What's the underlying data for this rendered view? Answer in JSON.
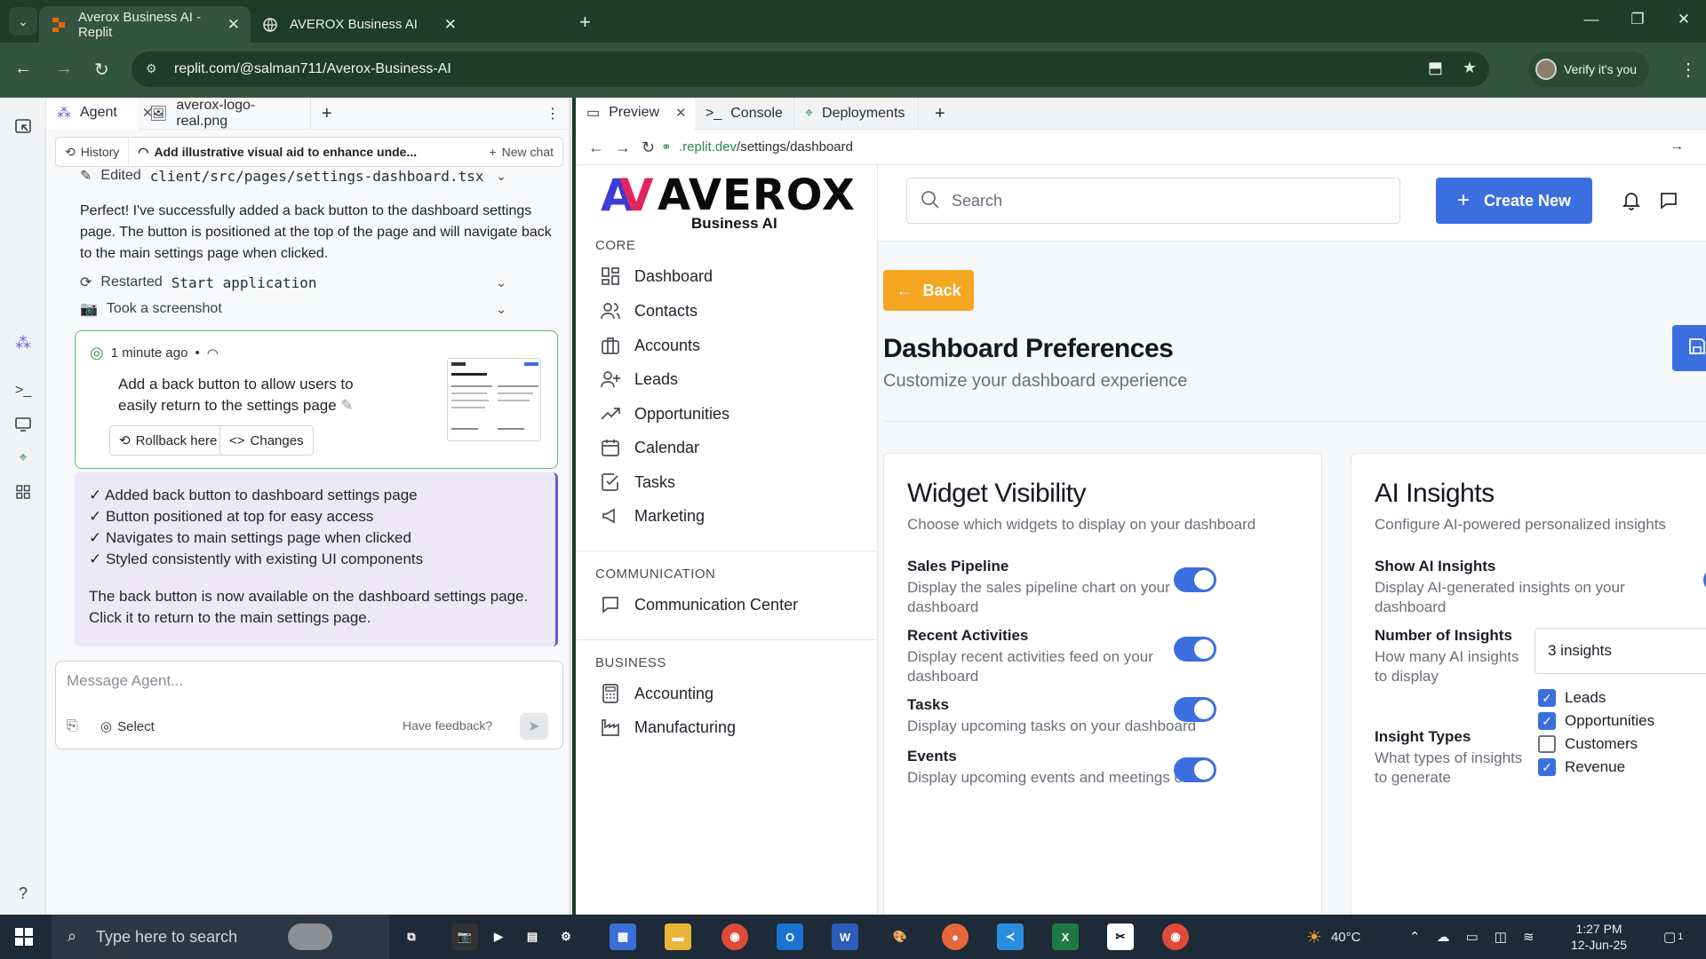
{
  "browser": {
    "tabs": [
      {
        "label": "Averox Business AI - Replit"
      },
      {
        "label": "AVEROX Business AI"
      }
    ],
    "url": "replit.com/@salman711/Averox-Business-AI",
    "profile_label": "Verify it's you"
  },
  "agent_panel": {
    "tabs": [
      {
        "label": "Agent"
      },
      {
        "label": "averox-logo-real.png"
      }
    ],
    "history_label": "History",
    "thread_title": "Add illustrative visual aid to enhance unde...",
    "new_chat_label": "New chat",
    "edited_prefix": "Edited",
    "edited_file": "client/src/pages/settings-dashboard.tsx",
    "message_1": "Perfect! I've successfully added a back button to the dashboard settings page. The button is positioned at the top of the page and will navigate back to the main settings page when clicked.",
    "restarted_prefix": "Restarted",
    "restarted_target": "Start application",
    "screenshot_label": "Took a screenshot",
    "checkpoint": {
      "time": "1 minute ago",
      "description": "Add a back button to allow users to easily return to the settings page",
      "rollback_label": "Rollback here",
      "changes_label": "Changes"
    },
    "summary_items": [
      "✓ Added back button to dashboard settings page",
      "✓ Button positioned at top for easy access",
      "✓ Navigates to main settings page when clicked",
      "✓ Styled consistently with existing UI components"
    ],
    "summary_footer": "The back button is now available on the dashboard settings page. Click it to return to the main settings page.",
    "input_placeholder": "Message Agent...",
    "select_label": "Select",
    "feedback_label": "Have feedback?"
  },
  "preview_panel": {
    "tabs": [
      {
        "label": "Preview"
      },
      {
        "label": "Console"
      },
      {
        "label": "Deployments"
      }
    ],
    "url_host": ".replit.dev",
    "url_path": "/settings/dashboard"
  },
  "app": {
    "logo_word": "AVEROX",
    "logo_mark": "AV",
    "logo_tagline": "Business AI",
    "sections": {
      "core": "CORE",
      "communication": "COMMUNICATION",
      "business": "BUSINESS"
    },
    "nav_core": [
      {
        "label": "Dashboard",
        "icon": "grid-icon"
      },
      {
        "label": "Contacts",
        "icon": "users-icon"
      },
      {
        "label": "Accounts",
        "icon": "briefcase-icon"
      },
      {
        "label": "Leads",
        "icon": "user-plus-icon"
      },
      {
        "label": "Opportunities",
        "icon": "trending-up-icon"
      },
      {
        "label": "Calendar",
        "icon": "calendar-icon"
      },
      {
        "label": "Tasks",
        "icon": "check-square-icon"
      },
      {
        "label": "Marketing",
        "icon": "megaphone-icon"
      }
    ],
    "nav_communication": [
      {
        "label": "Communication Center",
        "icon": "message-square-icon"
      }
    ],
    "nav_business": [
      {
        "label": "Accounting",
        "icon": "calculator-icon"
      },
      {
        "label": "Manufacturing",
        "icon": "factory-icon"
      }
    ],
    "search_placeholder": "Search",
    "create_label": "Create New",
    "back_label": "Back",
    "page_title": "Dashboard Preferences",
    "page_subtitle": "Customize your dashboard experience",
    "widget_card": {
      "title": "Widget Visibility",
      "subtitle": "Choose which widgets to display on your dashboard",
      "options": [
        {
          "title": "Sales Pipeline",
          "desc": "Display the sales pipeline chart on your dashboard",
          "enabled": true
        },
        {
          "title": "Recent Activities",
          "desc": "Display recent activities feed on your dashboard",
          "enabled": true
        },
        {
          "title": "Tasks",
          "desc": "Display upcoming tasks on your dashboard",
          "enabled": true
        },
        {
          "title": "Events",
          "desc": "Display upcoming events and meetings on",
          "enabled": true
        }
      ]
    },
    "ai_card": {
      "title": "AI Insights",
      "subtitle": "Configure AI-powered personalized insights",
      "show_title": "Show AI Insights",
      "show_desc": "Display AI-generated insights on your dashboard",
      "count_title": "Number of Insights",
      "count_desc": "How many AI insights to display",
      "count_value": "3 insights",
      "types_title": "Insight Types",
      "types_desc": "What types of insights to generate",
      "types": [
        {
          "label": "Leads",
          "checked": true
        },
        {
          "label": "Opportunities",
          "checked": true
        },
        {
          "label": "Customers",
          "checked": false
        },
        {
          "label": "Revenue",
          "checked": true
        }
      ]
    }
  },
  "taskbar": {
    "search_placeholder": "Type here to search",
    "temperature": "40°C",
    "time": "1:27 PM",
    "date": "12-Jun-25",
    "notification_count": "1"
  },
  "colors": {
    "accent_blue": "#3b6fe0",
    "back_orange": "#f5a623",
    "chrome_green": "#1f3b2b"
  }
}
